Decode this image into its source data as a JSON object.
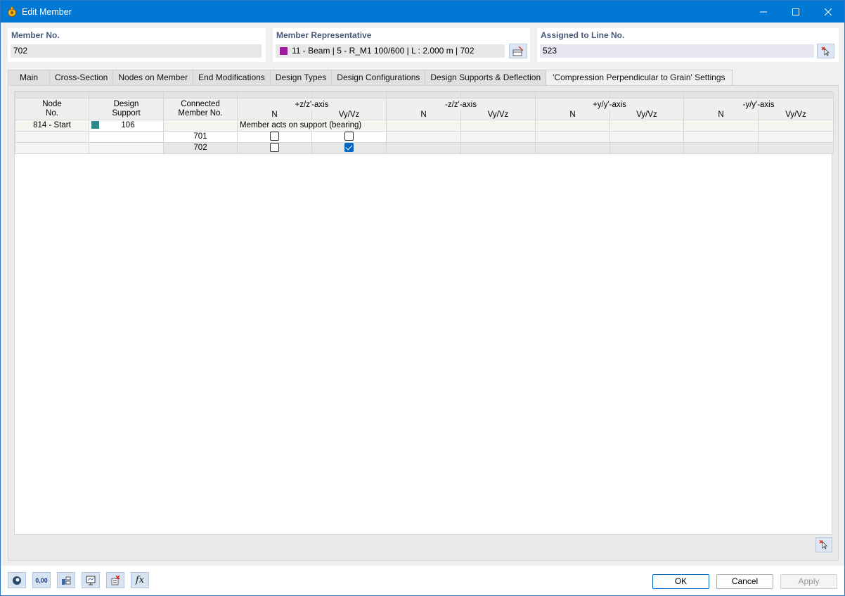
{
  "window": {
    "title": "Edit Member"
  },
  "header": {
    "member_no": {
      "label": "Member No.",
      "value": "702"
    },
    "member_rep": {
      "label": "Member Representative",
      "value": "11 - Beam | 5 - R_M1 100/600 | L : 2.000 m | 702",
      "color": "#a0189c"
    },
    "assigned_line": {
      "label": "Assigned to Line No.",
      "value": "523"
    }
  },
  "tabs": [
    {
      "label": "Main"
    },
    {
      "label": "Cross-Section"
    },
    {
      "label": "Nodes on Member"
    },
    {
      "label": "End Modifications"
    },
    {
      "label": "Design Types"
    },
    {
      "label": "Design Configurations"
    },
    {
      "label": "Design Supports & Deflection"
    },
    {
      "label": "'Compression Perpendicular to Grain' Settings",
      "active": true
    }
  ],
  "grid": {
    "columns": {
      "node_no": "Node\nNo.",
      "design_support": "Design\nSupport",
      "connected_member": "Connected\nMember No.",
      "pz_axis": "+z/z'-axis",
      "mz_axis": "-z/z'-axis",
      "py_axis": "+y/y'-axis",
      "my_axis": "-y/y'-axis",
      "n": "N",
      "vy_vz": "Vy/Vz"
    },
    "rows": {
      "node": "814 - Start",
      "support_no": "106",
      "support_color": "#2e8b8b",
      "group_text": "Member acts on support (bearing)",
      "members": [
        {
          "member": "701",
          "n_checked": false,
          "v_checked": false
        },
        {
          "member": "702",
          "n_checked": false,
          "v_checked": true
        }
      ]
    }
  },
  "buttons": {
    "ok": "OK",
    "cancel": "Cancel",
    "apply": "Apply"
  },
  "toolbar_icons": [
    "help-icon",
    "units-icon",
    "model-icon",
    "display-icon",
    "delete-icon",
    "formula-icon"
  ],
  "units_icon_text": "0,00",
  "formula_icon_text": "fx"
}
